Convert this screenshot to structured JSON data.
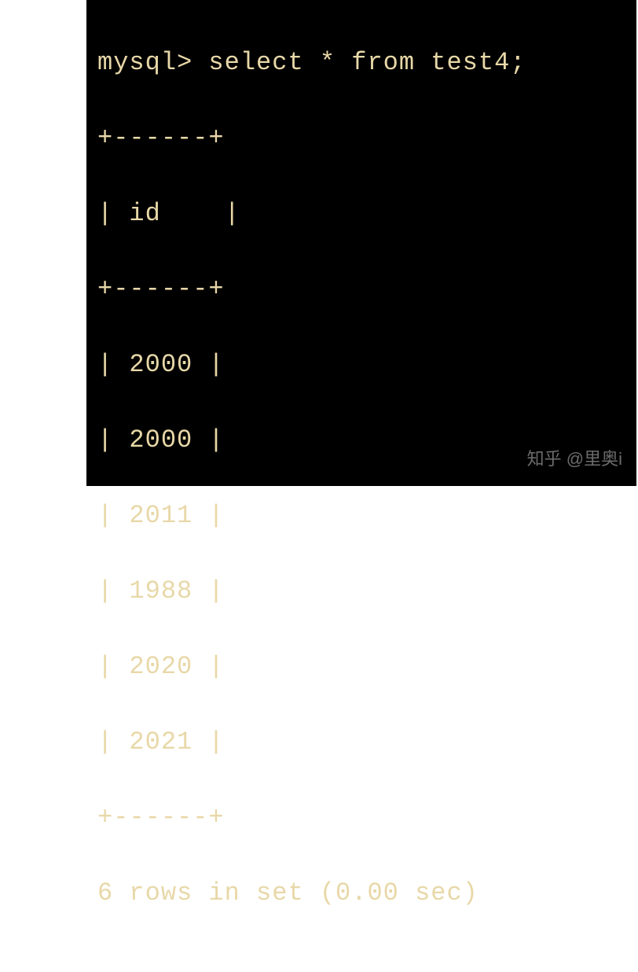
{
  "prompt": "mysql>",
  "command": "select * from test4;",
  "table": {
    "border": "+------+",
    "header_pipe_left": "| ",
    "header_label": "id",
    "header_pad": "   ",
    "header_pipe_right": " |",
    "row_pipe_left": "| ",
    "row_pipe_right": " |",
    "rows": [
      "2000",
      "2000",
      "2011",
      "1988",
      "2020",
      "2021"
    ]
  },
  "status": "6 rows in set (0.00 sec)",
  "watermark": "知乎 @里奥i"
}
